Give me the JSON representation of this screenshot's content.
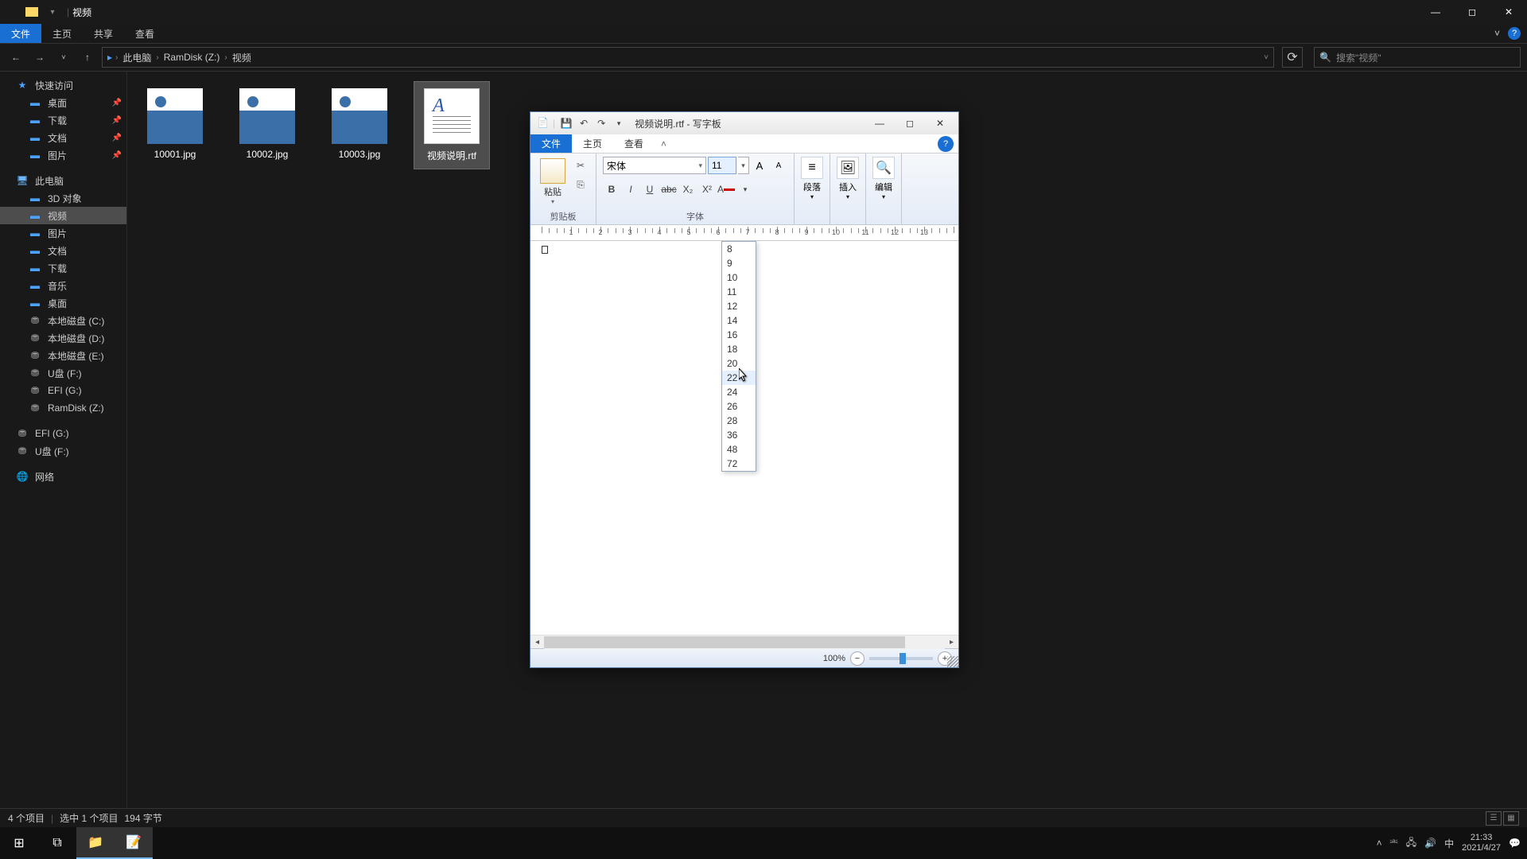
{
  "explorer": {
    "title": "视频",
    "ribbon_tabs": {
      "file": "文件",
      "home": "主页",
      "share": "共享",
      "view": "查看"
    },
    "breadcrumb": [
      "此电脑",
      "RamDisk (Z:)",
      "视频"
    ],
    "search_placeholder": "搜索\"视频\"",
    "sidebar": {
      "quick_access": "快速访问",
      "quick_items": [
        {
          "label": "桌面",
          "pin": true
        },
        {
          "label": "下载",
          "pin": true
        },
        {
          "label": "文档",
          "pin": true
        },
        {
          "label": "图片",
          "pin": true
        }
      ],
      "this_pc": "此电脑",
      "pc_items": [
        {
          "label": "3D 对象",
          "icon": "folder"
        },
        {
          "label": "视频",
          "icon": "folder",
          "active": true
        },
        {
          "label": "图片",
          "icon": "folder"
        },
        {
          "label": "文档",
          "icon": "folder"
        },
        {
          "label": "下载",
          "icon": "folder"
        },
        {
          "label": "音乐",
          "icon": "folder"
        },
        {
          "label": "桌面",
          "icon": "folder"
        },
        {
          "label": "本地磁盘 (C:)",
          "icon": "drive"
        },
        {
          "label": "本地磁盘 (D:)",
          "icon": "drive"
        },
        {
          "label": "本地磁盘 (E:)",
          "icon": "drive"
        },
        {
          "label": "U盘 (F:)",
          "icon": "drive"
        },
        {
          "label": "EFI (G:)",
          "icon": "drive"
        },
        {
          "label": "RamDisk (Z:)",
          "icon": "drive"
        }
      ],
      "extra_drives": [
        {
          "label": "EFI (G:)",
          "icon": "drive"
        },
        {
          "label": "U盘 (F:)",
          "icon": "drive"
        }
      ],
      "network": "网络"
    },
    "files": [
      {
        "name": "10001.jpg",
        "type": "img"
      },
      {
        "name": "10002.jpg",
        "type": "img"
      },
      {
        "name": "10003.jpg",
        "type": "img"
      },
      {
        "name": "视频说明.rtf",
        "type": "rtf",
        "selected": true
      }
    ],
    "status": {
      "count": "4 个项目",
      "selected": "选中 1 个项目",
      "size": "194 字节"
    }
  },
  "wordpad": {
    "title": "视频说明.rtf - 写字板",
    "tabs": {
      "file": "文件",
      "home": "主页",
      "view": "查看"
    },
    "clipboard_label": "剪贴板",
    "paste_label": "粘贴",
    "font_label": "字体",
    "font_name": "宋体",
    "font_size": "11",
    "paragraph_label": "段落",
    "insert_label": "插入",
    "edit_label": "编辑",
    "ruler_nums": [
      "1",
      "2",
      "3",
      "4",
      "5",
      "6",
      "7",
      "8",
      "9",
      "10",
      "11",
      "12",
      "13"
    ],
    "size_options": [
      "8",
      "9",
      "10",
      "11",
      "12",
      "14",
      "16",
      "18",
      "20",
      "22",
      "24",
      "26",
      "28",
      "36",
      "48",
      "72"
    ],
    "size_hover": "22",
    "zoom": "100%"
  },
  "taskbar": {
    "time": "21:33",
    "date": "2021/4/27",
    "ime": "中"
  }
}
